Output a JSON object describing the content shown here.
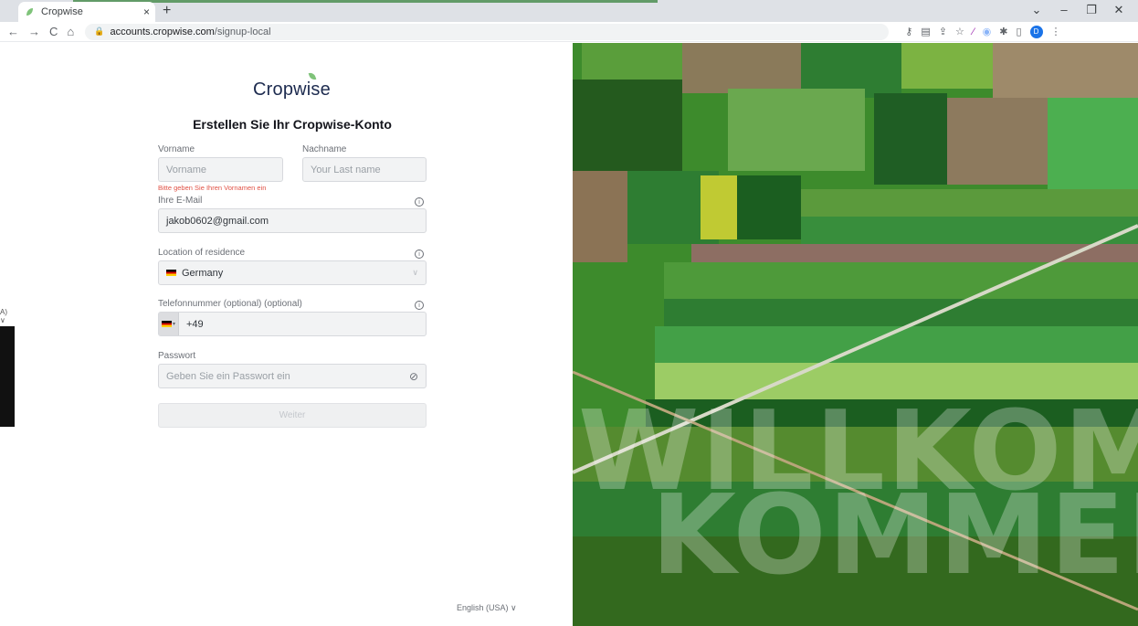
{
  "browser": {
    "tab_title": "Cropwise",
    "tab_close": "×",
    "new_tab": "+",
    "url_host": "accounts.cropwise.com",
    "url_path": "/signup-local",
    "window_controls": [
      "⌄",
      "–",
      "❐",
      "✕"
    ],
    "profile_initial": "D"
  },
  "background_window": {
    "fragment_label": "A) ∨"
  },
  "signup": {
    "logo_text": "Cropwise",
    "heading": "Erstellen Sie Ihr Cropwise-Konto",
    "first_name": {
      "label": "Vorname",
      "placeholder": "Vorname",
      "error": "Bitte geben Sie Ihren Vornamen ein"
    },
    "last_name": {
      "label": "Nachname",
      "placeholder": "Your Last name"
    },
    "email": {
      "label": "Ihre E-Mail",
      "value": "jakob0602@gmail.com"
    },
    "residence": {
      "label": "Location of residence",
      "value": "Germany"
    },
    "phone": {
      "label": "Telefonnummer (optional) (optional)",
      "value": "+49"
    },
    "password": {
      "label": "Passwort",
      "placeholder": "Geben Sie ein Passwort ein"
    },
    "submit_label": "Weiter",
    "language_selector": "English (USA) ∨"
  },
  "hero": {
    "line1": "WILLKOMM",
    "line2": "KOMMEN"
  },
  "colors": {
    "brand_navy": "#1d2b4f",
    "error_red": "#e05145",
    "leaf_green": "#7fc37a"
  }
}
